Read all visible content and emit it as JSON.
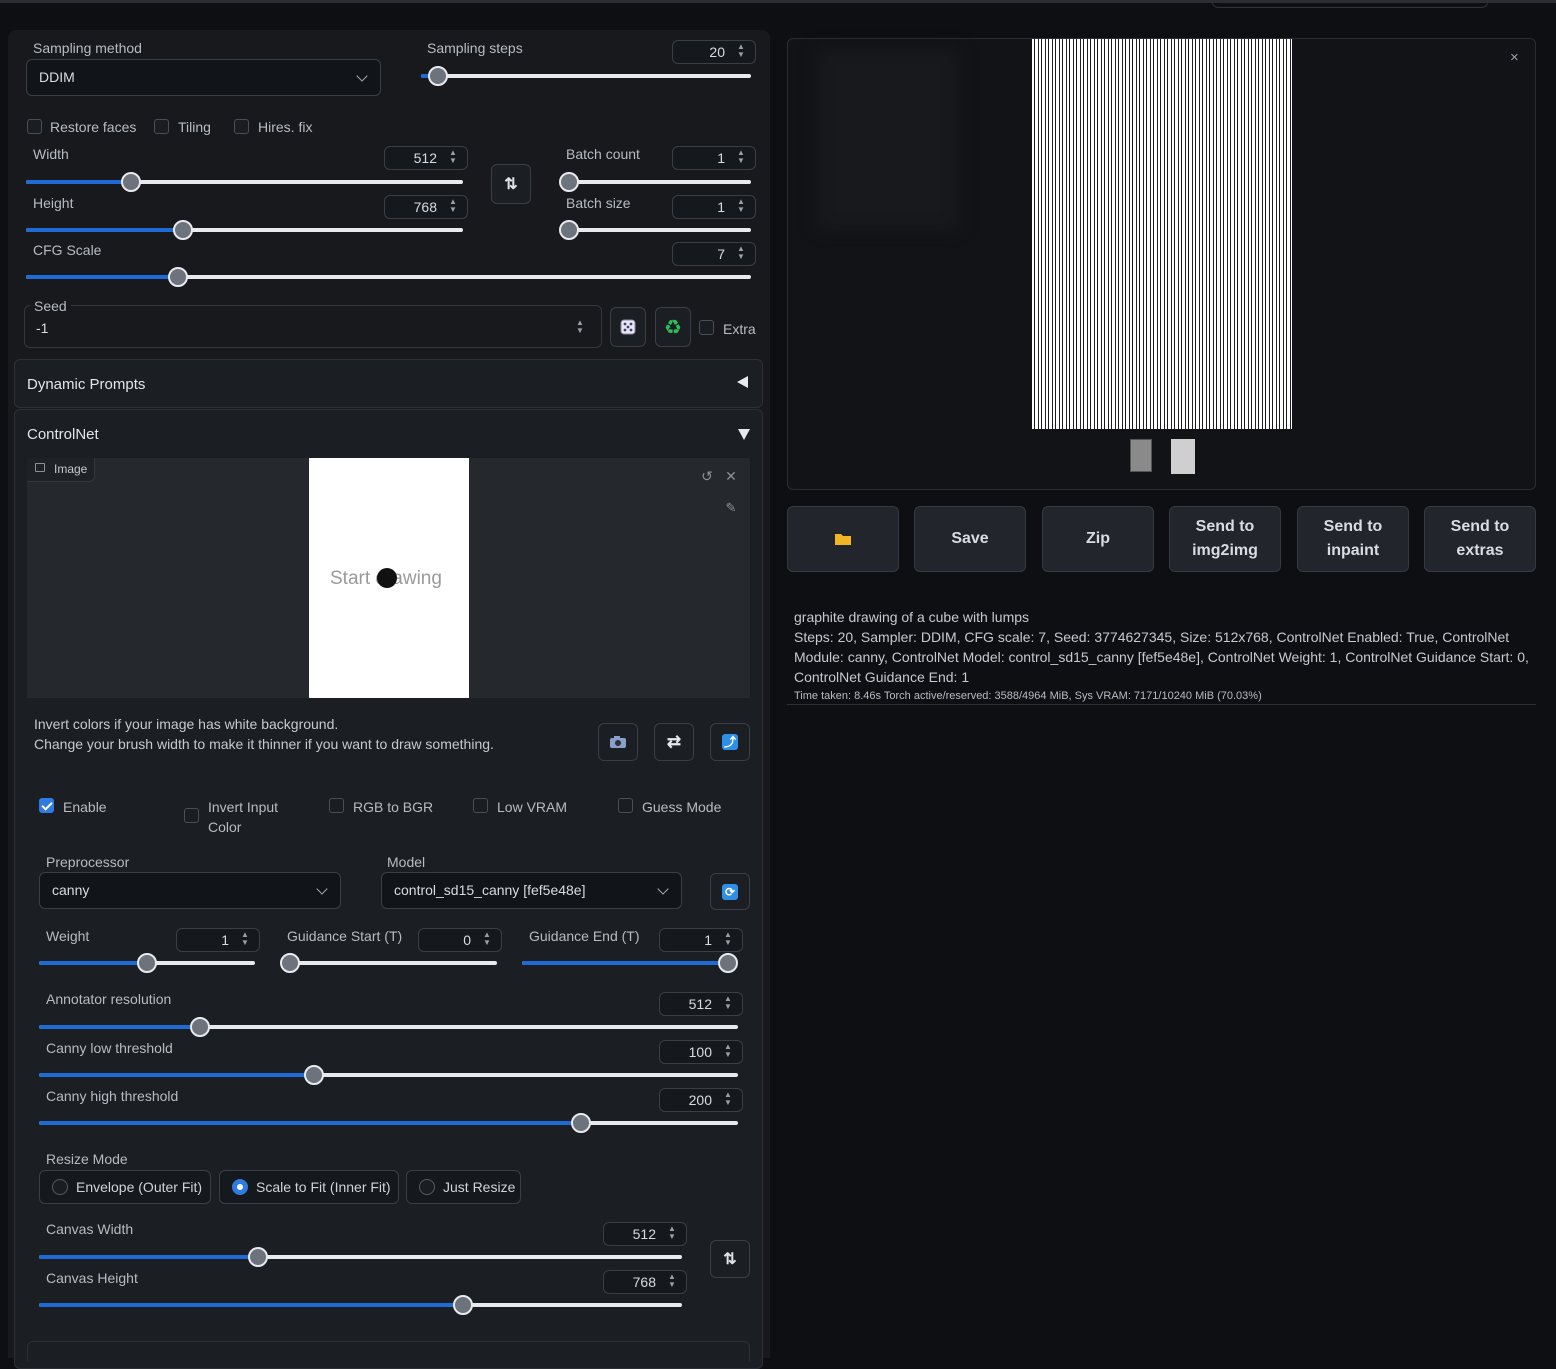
{
  "sampling": {
    "method_label": "Sampling method",
    "method_value": "DDIM",
    "steps_label": "Sampling steps",
    "steps_value": "20",
    "steps_fraction": 0.05
  },
  "checkboxes": {
    "restore_faces": "Restore faces",
    "tiling": "Tiling",
    "hires_fix": "Hires. fix"
  },
  "width": {
    "label": "Width",
    "value": "512",
    "fraction": 0.24
  },
  "height": {
    "label": "Height",
    "value": "768",
    "fraction": 0.36
  },
  "batch_count": {
    "label": "Batch count",
    "value": "1",
    "fraction": 0
  },
  "batch_size": {
    "label": "Batch size",
    "value": "1",
    "fraction": 0
  },
  "cfg": {
    "label": "CFG Scale",
    "value": "7",
    "fraction": 0.21
  },
  "seed": {
    "label": "Seed",
    "value": "-1",
    "extra_label": "Extra"
  },
  "accordions": {
    "dynamic_prompts": "Dynamic Prompts",
    "controlnet": "ControlNet"
  },
  "controlnet": {
    "image_tab": "Image",
    "canvas_hint": "Start drawing",
    "help_line1": "Invert colors if your image has white background.",
    "help_line2": "Change your brush width to make it thinner if you want to draw something.",
    "enable": "Enable",
    "invert_input_line1": "Invert Input",
    "invert_input_line2": "Color",
    "rgb_to_bgr": "RGB to BGR",
    "low_vram": "Low VRAM",
    "guess_mode": "Guess Mode",
    "preprocessor_label": "Preprocessor",
    "preprocessor_value": "canny",
    "model_label": "Model",
    "model_value": "control_sd15_canny [fef5e48e]",
    "weight_label": "Weight",
    "weight_value": "1",
    "weight_fraction": 0.5,
    "gstart_label": "Guidance Start (T)",
    "gstart_value": "0",
    "gstart_fraction": 0,
    "gend_label": "Guidance End (T)",
    "gend_value": "1",
    "gend_fraction": 1,
    "annot_label": "Annotator resolution",
    "annot_value": "512",
    "annot_fraction": 0.23,
    "low_label": "Canny low threshold",
    "low_value": "100",
    "low_fraction": 0.394,
    "high_label": "Canny high threshold",
    "high_value": "200",
    "high_fraction": 0.776,
    "resize_label": "Resize Mode",
    "resize_options": [
      "Envelope (Outer Fit)",
      "Scale to Fit (Inner Fit)",
      "Just Resize"
    ],
    "canvas_width_label": "Canvas Width",
    "canvas_width_value": "512",
    "canvas_width_fraction": 0.34,
    "canvas_height_label": "Canvas Height",
    "canvas_height_value": "768",
    "canvas_height_fraction": 0.66
  },
  "output": {
    "buttons": {
      "save": "Save",
      "zip": "Zip",
      "img2img_l1": "Send to",
      "img2img_l2": "img2img",
      "inpaint_l1": "Send to",
      "inpaint_l2": "inpaint",
      "extras_l1": "Send to",
      "extras_l2": "extras"
    },
    "prompt": "graphite drawing of a cube with lumps",
    "params_line1": "Steps: 20, Sampler: DDIM, CFG scale: 7, Seed: 3774627345, Size: 512x768, ControlNet Enabled: True, ControlNet",
    "params_line2": "Module: canny, ControlNet Model: control_sd15_canny [fef5e48e], ControlNet Weight: 1, ControlNet Guidance Start: 0,",
    "params_line3": "ControlNet Guidance End: 1",
    "timing": "Time taken: 8.46s  Torch active/reserved: 3588/4964 MiB, Sys VRAM: 7171/10240 MiB (70.03%)"
  },
  "colors": {
    "accent": "#1f6bd6",
    "panel": "#1a1d21",
    "background": "#0d0f12"
  }
}
